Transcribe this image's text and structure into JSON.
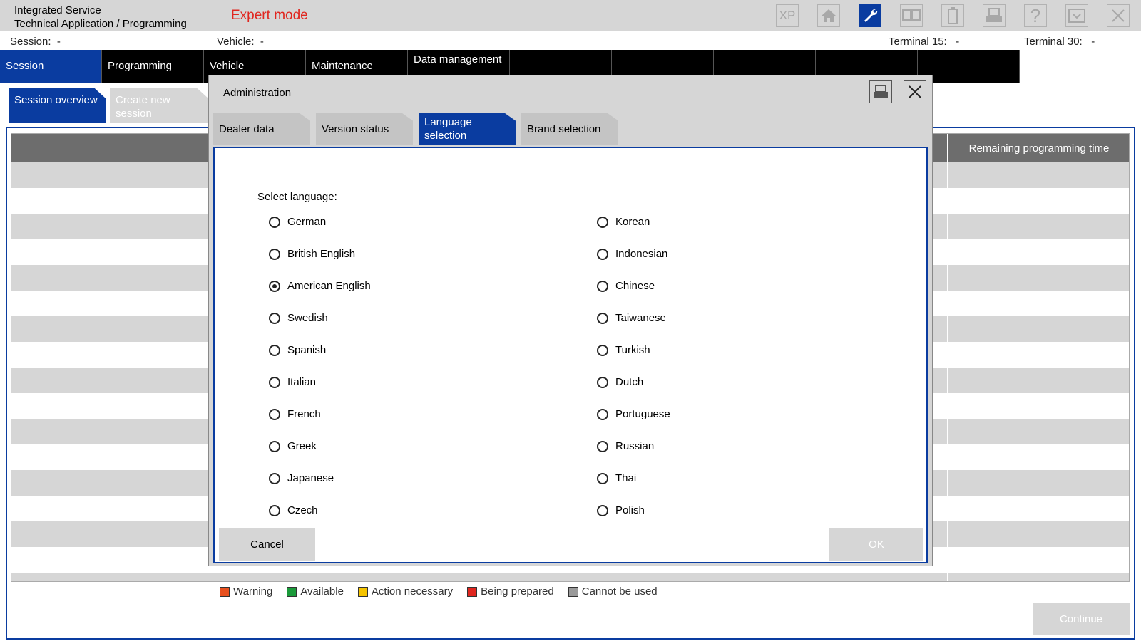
{
  "app": {
    "title_line1": "Integrated Service",
    "title_line2": "Technical Application / Programming",
    "mode": "Expert mode"
  },
  "toolbar": {
    "icons": [
      "xp-text",
      "home-icon",
      "wrench-icon",
      "split-window-icon",
      "battery-icon",
      "print-icon",
      "help-icon",
      "minimize-icon",
      "close-icon"
    ],
    "xp_label": "XP",
    "help_label": "?",
    "active_color": "#0a3ca0"
  },
  "info": {
    "session_label": "Session:",
    "session_value": "-",
    "vehicle_label": "Vehicle:",
    "vehicle_value": "-",
    "terminal15_label": "Terminal 15:",
    "terminal15_value": "-",
    "terminal30_label": "Terminal 30:",
    "terminal30_value": "-"
  },
  "mainnav": {
    "tabs": [
      "Session",
      "Programming",
      "Vehicle",
      "Maintenance",
      "Data management",
      "",
      "",
      "",
      "",
      ""
    ],
    "active_index": 0
  },
  "subnav": {
    "session_overview": "Session overview",
    "create_new_session": "Create new session"
  },
  "table": {
    "remaining_col": "Remaining programming time"
  },
  "legend": {
    "items": [
      {
        "label": "Warning",
        "color": "#e8501e"
      },
      {
        "label": "Available",
        "color": "#1a9a3a"
      },
      {
        "label": "Action necessary",
        "color": "#f5c400"
      },
      {
        "label": "Being prepared",
        "color": "#e0261f"
      },
      {
        "label": "Cannot be used",
        "color": "#9a9a9a"
      }
    ]
  },
  "continue_label": "Continue",
  "dialog": {
    "title": "Administration",
    "tabs": [
      "Dealer data",
      "Version status",
      "Language selection",
      "Brand selection"
    ],
    "active_tab": 2,
    "prompt": "Select language:",
    "languages_left": [
      "German",
      "British English",
      "American English",
      "Swedish",
      "Spanish",
      "Italian",
      "French",
      "Greek",
      "Japanese",
      "Czech"
    ],
    "languages_right": [
      "Korean",
      "Indonesian",
      "Chinese",
      "Taiwanese",
      "Turkish",
      "Dutch",
      "Portuguese",
      "Russian",
      "Thai",
      "Polish"
    ],
    "selected": "American English",
    "cancel_label": "Cancel",
    "ok_label": "OK"
  }
}
